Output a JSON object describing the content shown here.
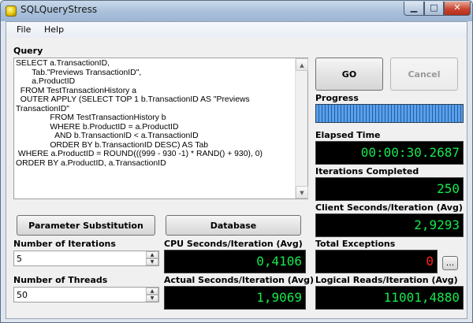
{
  "window": {
    "title": "SQLQueryStress",
    "minimize_glyph": "▁",
    "maximize_glyph": "□",
    "close_glyph": "✕"
  },
  "menu": {
    "file": "File",
    "help": "Help"
  },
  "query": {
    "label": "Query",
    "text": "SELECT a.TransactionID,\n       Tab.\"Previews TransactionID\",\n       a.ProductID\n  FROM TestTransactionHistory a\n  OUTER APPLY (SELECT TOP 1 b.TransactionID AS \"Previews\nTransactionID\"\n               FROM TestTransactionHistory b\n               WHERE b.ProductID = a.ProductID\n                 AND b.TransactionID < a.TransactionID\n               ORDER BY b.TransactionID DESC) AS Tab\n WHERE a.ProductID = ROUND(((999 - 930 -1) * RAND() + 930), 0)\nORDER BY a.ProductID, a.TransactionID"
  },
  "buttons": {
    "go": "GO",
    "cancel": "Cancel",
    "parameter_substitution": "Parameter Substitution",
    "database": "Database",
    "ellipsis": "..."
  },
  "progress": {
    "label": "Progress",
    "value": 1.0
  },
  "elapsed": {
    "label": "Elapsed Time",
    "value": "00:00:30.2687"
  },
  "iterations_completed": {
    "label": "Iterations Completed",
    "value": "250"
  },
  "client_seconds": {
    "label": "Client Seconds/Iteration (Avg)",
    "value": "2,9293"
  },
  "cpu_seconds": {
    "label": "CPU Seconds/Iteration (Avg)",
    "value": "0,4106"
  },
  "total_exceptions": {
    "label": "Total Exceptions",
    "value": "0"
  },
  "actual_seconds": {
    "label": "Actual Seconds/Iteration (Avg)",
    "value": "1,9069"
  },
  "logical_reads": {
    "label": "Logical Reads/Iteration (Avg)",
    "value": "11001,4880"
  },
  "iterations": {
    "label": "Number of Iterations",
    "value": "5"
  },
  "threads": {
    "label": "Number of Threads",
    "value": "50"
  },
  "icons": [
    "app-icon",
    "scroll-up-icon",
    "scroll-down-icon",
    "spin-up-icon",
    "spin-down-icon"
  ],
  "colors": {
    "lcd_green": "#16e84d",
    "lcd_red": "#ff2020",
    "lcd_bg": "#000000",
    "progress_blue": "#5aa0e8"
  }
}
